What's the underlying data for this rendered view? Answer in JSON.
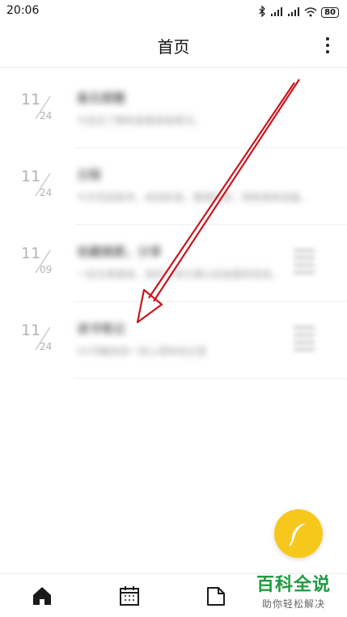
{
  "status_bar": {
    "time": "20:06",
    "battery": "80",
    "icons": [
      "bluetooth-icon",
      "signal-icon",
      "signal-icon",
      "wifi-icon",
      "battery-icon"
    ]
  },
  "header": {
    "title": "首页",
    "menu_icon": "more-vertical-icon"
  },
  "notes": [
    {
      "day": "11",
      "month": "24",
      "title": "备忘提醒",
      "snippet": "今后应了解和查看家庭情况。",
      "has_thumb": false
    },
    {
      "day": "11",
      "month": "24",
      "title": "日程",
      "snippet": "今天完成家务，收拾卧室，整理衣柜，购物清单准备。",
      "has_thumb": false
    },
    {
      "day": "11",
      "month": "09",
      "title": "收藏摘要，分享",
      "snippet": "一些文章摘录，保存下来方便以后查看和阅读。",
      "has_thumb": true
    },
    {
      "day": "11",
      "month": "24",
      "title": "读书笔记",
      "snippet": "XX书籍阅读一些心得体会记录",
      "has_thumb": true
    }
  ],
  "fab": {
    "icon": "feather-icon",
    "color": "#f7c81c"
  },
  "bottom_nav": [
    {
      "icon": "home-icon",
      "active": true
    },
    {
      "icon": "calendar-icon",
      "active": false
    },
    {
      "icon": "folder-icon",
      "active": false
    }
  ],
  "watermark": {
    "main": "百科全说",
    "sub": "助你轻松解决"
  },
  "colors": {
    "accent": "#f7c81c",
    "arrow": "#c8161d",
    "watermark": "#1f9a3f"
  }
}
